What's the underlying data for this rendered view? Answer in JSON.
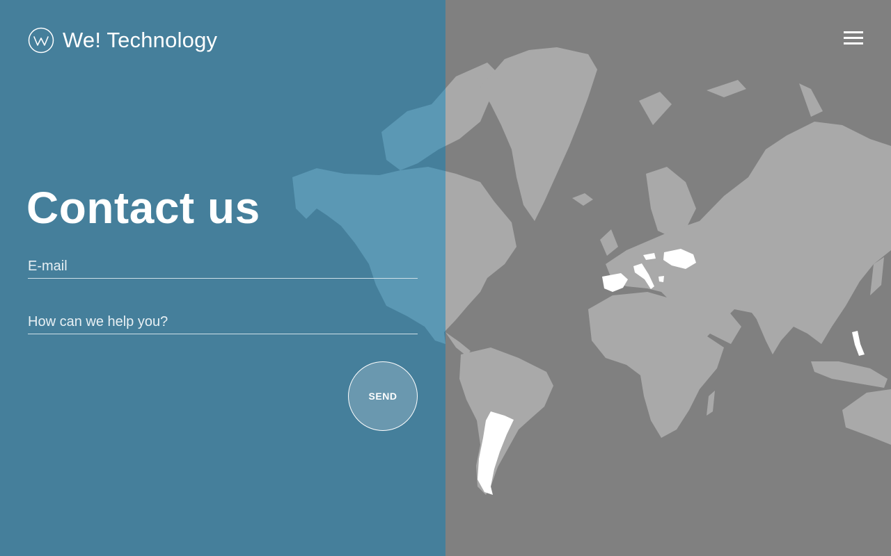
{
  "brand": {
    "name": "We! Technology",
    "logo_icon": "w-circle-logo"
  },
  "header": {
    "menu_icon": "hamburger-menu-icon"
  },
  "contact": {
    "title": "Contact us",
    "email_placeholder": "E-mail",
    "message_placeholder": "How can we help you?",
    "send_label": "SEND"
  },
  "map": {
    "highlighted_countries": [
      "Spain",
      "Italy",
      "Czech Republic",
      "Ukraine",
      "Greece",
      "Argentina",
      "Philippines"
    ]
  },
  "colors": {
    "panel": "#457f9b",
    "background": "#808080",
    "land": "#a9a9a9",
    "highlight": "#ffffff"
  }
}
